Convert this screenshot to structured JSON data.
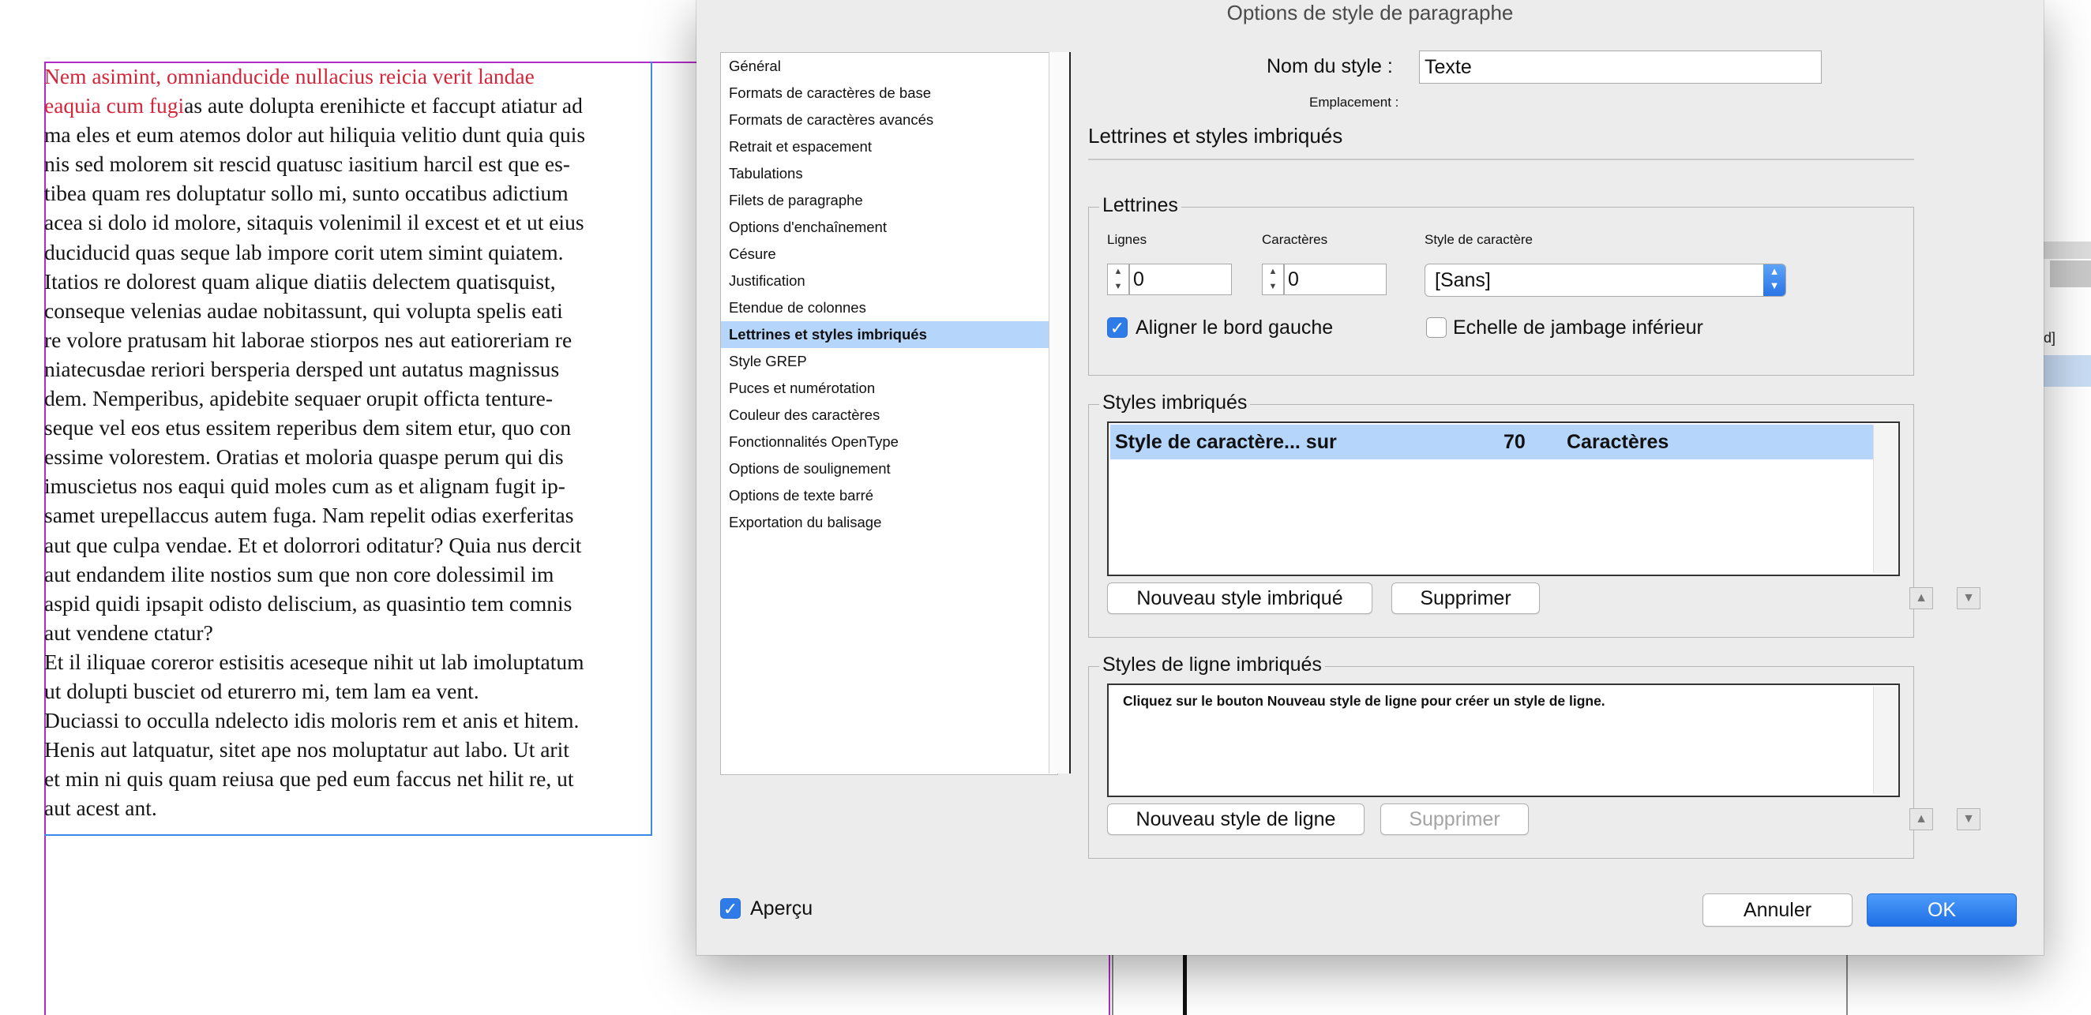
{
  "document": {
    "lines": [
      {
        "red": "Nem asimint, omnianducide nullacius reicia verit landae",
        "rest": ""
      },
      {
        "red": "eaquia cum fugi",
        "rest": "as aute dolupta erenihicte et faccupt atiatur ad"
      },
      {
        "red": "",
        "rest": "ma eles et eum atemos dolor aut hiliquia velitio dunt quia quis"
      },
      {
        "red": "",
        "rest": "nis sed molorem sit rescid quatusc iasitium harcil est que es-"
      },
      {
        "red": "",
        "rest": "tibea quam res doluptatur sollo mi, sunto occatibus adictium"
      },
      {
        "red": "",
        "rest": "acea si dolo id molore, sitaquis volenimil il excest et et ut eius"
      },
      {
        "red": "",
        "rest": "ducidu­cid quas seque lab impore corit utem simint quiatem."
      },
      {
        "red": "",
        "rest": "Itatios re dolorest quam alique diatiis delectem quatisquist,"
      },
      {
        "red": "",
        "rest": "conseque velenias audae nobitassunt, qui volupta spelis eati"
      },
      {
        "red": "",
        "rest": "re volore pratusam hit laborae stiorpos nes aut eatioreriam re"
      },
      {
        "red": "",
        "rest": "niatecusdae reriori bersperia dersped unt autatus magnissus"
      },
      {
        "red": "",
        "rest": "dem. Nemperibus, apidebite sequaer orupit officta tenture-"
      },
      {
        "red": "",
        "rest": "seque vel eos etus essitem reperibus dem sitem etur, quo con"
      },
      {
        "red": "",
        "rest": "essime volorestem. Oratias et moloria quaspe perum qui dis"
      },
      {
        "red": "",
        "rest": "imuscietus nos eaqui quid moles cum as et alignam fugit ip-"
      },
      {
        "red": "",
        "rest": "samet urepellaccus autem fuga. Nam repelit odias exerferitas"
      },
      {
        "red": "",
        "rest": "aut que culpa vendae. Et et dolorrori oditatur? Quia nus dercit"
      },
      {
        "red": "",
        "rest": "aut endandem ilite nostios sum que non core dolessimil im"
      },
      {
        "red": "",
        "rest": "aspid quidi ipsapit odisto deliscium, as quasintio tem comnis"
      },
      {
        "red": "",
        "rest": "aut vendene ctatur?"
      },
      {
        "red": "",
        "rest": "Et il iliquae coreror estisitis aceseque nihit ut lab imoluptatum"
      },
      {
        "red": "",
        "rest": "ut dolupti busciet od eturerro mi, tem lam ea vent."
      },
      {
        "red": "",
        "rest": "Duciassi to occulla ndelecto idis moloris rem et anis et hitem."
      },
      {
        "red": "",
        "rest": "Henis aut latquatur, sitet ape nos moluptatur aut labo. Ut arit"
      },
      {
        "red": "",
        "rest": "et min ni quis quam reiusa que ped eum faccus net hilit re, ut"
      },
      {
        "red": "",
        "rest": "aut acest ant."
      }
    ],
    "panel_fragment": "d]"
  },
  "dialog": {
    "title": "Options de style de paragraphe",
    "categories": [
      "Général",
      "Formats de caractères de base",
      "Formats de caractères avancés",
      "Retrait et espacement",
      "Tabulations",
      "Filets de paragraphe",
      "Options d'enchaînement",
      "Césure",
      "Justification",
      "Etendue de colonnes",
      "Lettrines et styles imbriqués",
      "Style GREP",
      "Puces et numérotation",
      "Couleur des caractères",
      "Fonctionnalités OpenType",
      "Options de soulignement",
      "Options de texte barré",
      "Exportation du balisage"
    ],
    "selected_category": "Lettrines et styles imbriqués",
    "style_name_label": "Nom du style :",
    "style_name_value": "Texte",
    "location_label": "Emplacement :",
    "section_title": "Lettrines et styles imbriqués",
    "dropcaps": {
      "legend": "Lettrines",
      "lines_label": "Lignes",
      "lines_value": "0",
      "chars_label": "Caractères",
      "chars_value": "0",
      "char_style_label": "Style de caractère",
      "char_style_value": "[Sans]",
      "align_left_label": "Aligner le bord gauche",
      "align_left_checked": true,
      "scale_descenders_label": "Echelle de jambage inférieur",
      "scale_descenders_checked": false
    },
    "nested": {
      "legend": "Styles imbriqués",
      "row": {
        "style": "Style de caractère... sur",
        "count": "70",
        "unit": "Caractères"
      },
      "new_button": "Nouveau style imbriqué",
      "delete_button": "Supprimer"
    },
    "nested_line": {
      "legend": "Styles de ligne imbriqués",
      "hint": "Cliquez sur le bouton Nouveau style de ligne pour créer un style de ligne.",
      "new_button": "Nouveau style de ligne",
      "delete_button": "Supprimer"
    },
    "preview_label": "Aperçu",
    "preview_checked": true,
    "cancel_button": "Annuler",
    "ok_button": "OK",
    "icons": {
      "up": "▲",
      "down": "▼",
      "check": "✓"
    }
  }
}
